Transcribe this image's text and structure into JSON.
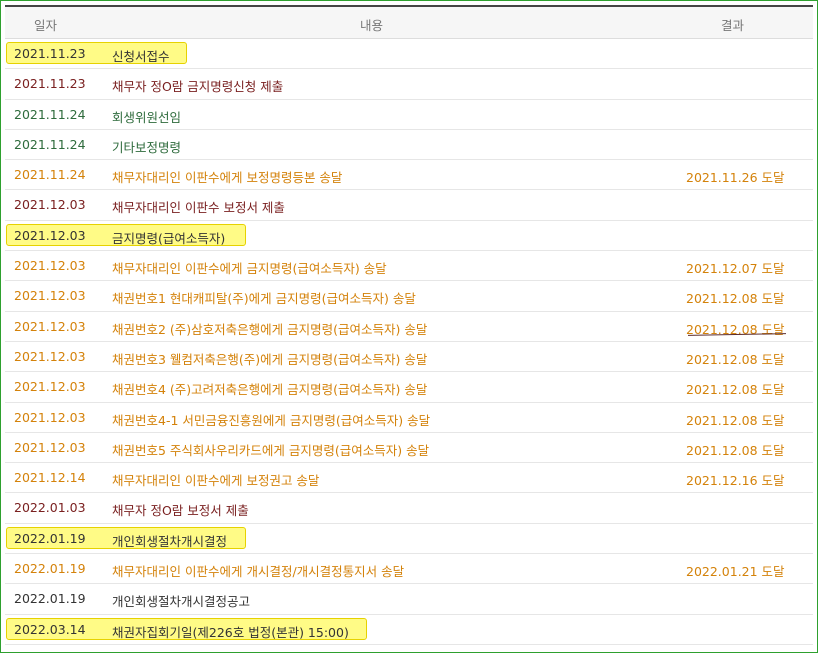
{
  "header": {
    "date": "일자",
    "content": "내용",
    "result": "결과"
  },
  "rows": [
    {
      "date": "2021.11.23",
      "content": "신청서접수",
      "result": "",
      "highlight": true
    },
    {
      "date": "2021.11.23",
      "content": "채무자 정O람 금지명령신청 제출",
      "result": ""
    },
    {
      "date": "2021.11.24",
      "content": "회생위원선임",
      "result": ""
    },
    {
      "date": "2021.11.24",
      "content": "기타보정명령",
      "result": ""
    },
    {
      "date": "2021.11.24",
      "content": "채무자대리인 이판수에게 보정명령등본 송달",
      "result": "2021.11.26 도달"
    },
    {
      "date": "2021.12.03",
      "content": "채무자대리인 이판수 보정서 제출",
      "result": ""
    },
    {
      "date": "2021.12.03",
      "content": "금지명령(급여소득자)",
      "result": "",
      "highlight": true
    },
    {
      "date": "2021.12.03",
      "content": "채무자대리인 이판수에게 금지명령(급여소득자) 송달",
      "result": "2021.12.07 도달"
    },
    {
      "date": "2021.12.03",
      "content": "채권번호1 현대캐피탈(주)에게 금지명령(급여소득자) 송달",
      "result": "2021.12.08 도달"
    },
    {
      "date": "2021.12.03",
      "content": "채권번호2 (주)삼호저축은행에게 금지명령(급여소득자) 송달",
      "result": "2021.12.08 도달"
    },
    {
      "date": "2021.12.03",
      "content": "채권번호3 웰컴저축은행(주)에게 금지명령(급여소득자) 송달",
      "result": "2021.12.08 도달"
    },
    {
      "date": "2021.12.03",
      "content": "채권번호4 (주)고려저축은행에게 금지명령(급여소득자) 송달",
      "result": "2021.12.08 도달"
    },
    {
      "date": "2021.12.03",
      "content": "채권번호4-1 서민금융진흥원에게 금지명령(급여소득자) 송달",
      "result": "2021.12.08 도달"
    },
    {
      "date": "2021.12.03",
      "content": "채권번호5 주식회사우리카드에게 금지명령(급여소득자) 송달",
      "result": "2021.12.08 도달"
    },
    {
      "date": "2021.12.14",
      "content": "채무자대리인 이판수에게 보정권고 송달",
      "result": "2021.12.16 도달"
    },
    {
      "date": "2022.01.03",
      "content": "채무자 정O람 보정서 제출",
      "result": ""
    },
    {
      "date": "2022.01.19",
      "content": "개인회생절차개시결정",
      "result": "",
      "highlight": true
    },
    {
      "date": "2022.01.19",
      "content": "채무자대리인 이판수에게 개시결정/개시결정통지서 송달",
      "result": "2022.01.21 도달"
    },
    {
      "date": "2022.01.19",
      "content": "개인회생절차개시결정공고",
      "result": ""
    },
    {
      "date": "2022.03.14",
      "content": "채권자집회기일(제226호 법정(본관) 15:00)",
      "result": "",
      "highlight": true
    }
  ],
  "colors": {
    "highlight_fill": "#fffb86",
    "highlight_border": "#e6d200",
    "black": "#333333",
    "maroon": "#7a2020",
    "green": "#2e6b3c",
    "orange": "#d4820a",
    "frame_border": "#2ea02e"
  }
}
